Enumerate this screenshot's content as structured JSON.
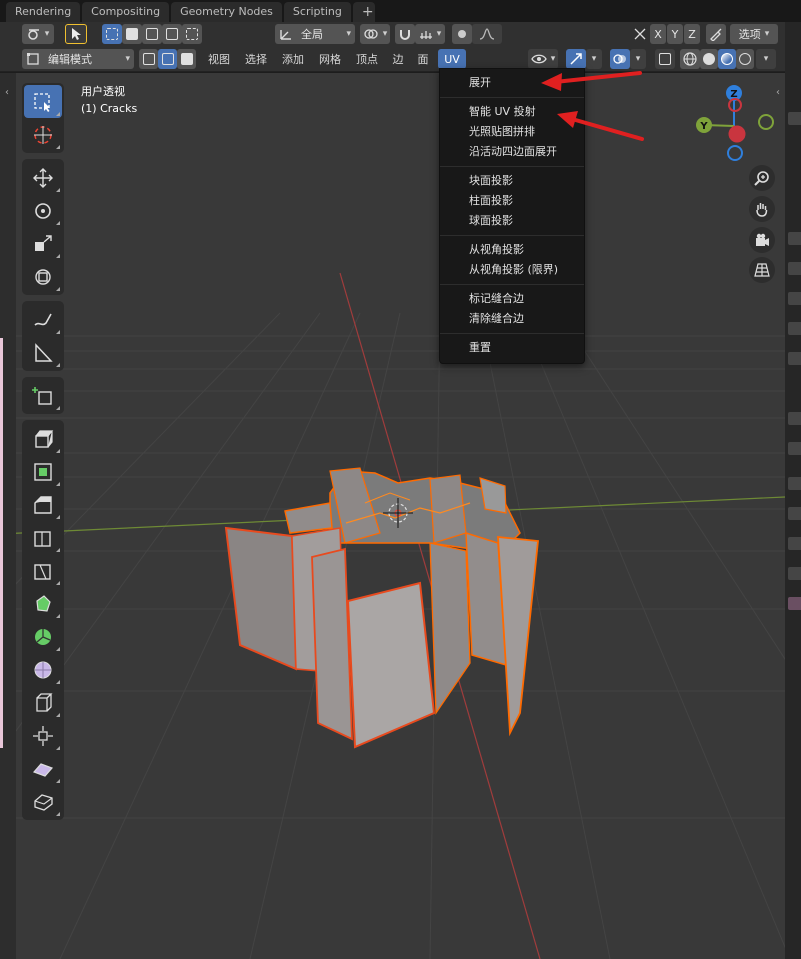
{
  "workspace_tabs": [
    "Rendering",
    "Compositing",
    "Geometry Nodes",
    "Scripting"
  ],
  "header": {
    "transform_orientation": "全局",
    "axis_x": "X",
    "axis_y": "Y",
    "axis_z": "Z",
    "options_label": "选项",
    "mode_label": "编辑模式",
    "menus": [
      "视图",
      "选择",
      "添加",
      "网格",
      "顶点",
      "边",
      "面",
      "UV"
    ]
  },
  "viewport": {
    "view_name": "用户透视",
    "object_name": "(1) Cracks"
  },
  "gizmo": {
    "z": "Z",
    "y": "Y"
  },
  "uv_menu": {
    "groups": [
      [
        "展开"
      ],
      [
        "智能 UV 投射",
        "光照贴图拼排",
        "沿活动四边面展开"
      ],
      [
        "块面投影",
        "柱面投影",
        "球面投影"
      ],
      [
        "从视角投影",
        "从视角投影 (限界)"
      ],
      [
        "标记缝合边",
        "清除缝合边"
      ],
      [
        "重置"
      ]
    ]
  },
  "colors": {
    "accent": "#4772b3",
    "selection_outline": "#ff6a00",
    "annotation_arrow": "#e02020",
    "x_axis": "#c9353f",
    "y_axis": "#7fa33a",
    "z_axis": "#2f7fdc"
  }
}
